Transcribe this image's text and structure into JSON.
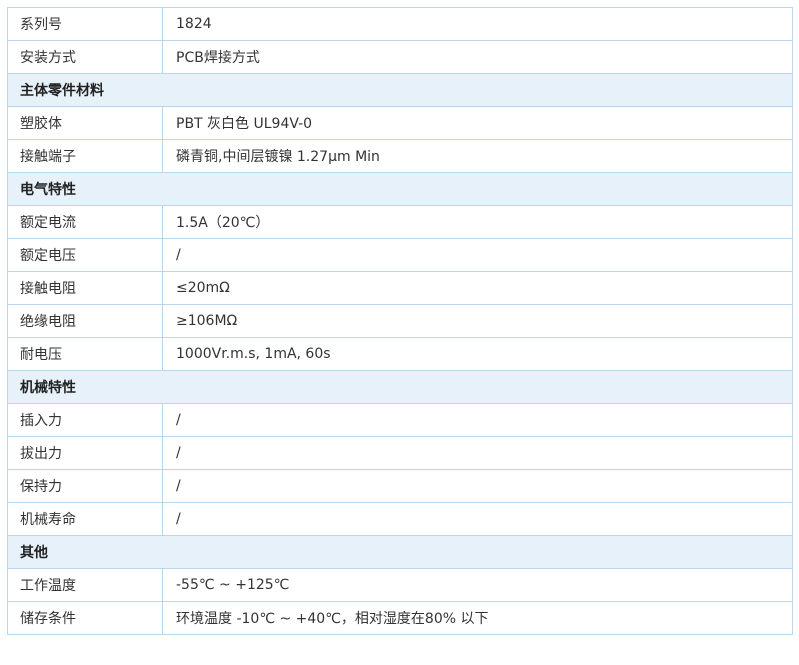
{
  "rows": [
    {
      "type": "row",
      "label": "系列号",
      "value": "1824"
    },
    {
      "type": "row",
      "label": "安装方式",
      "value": "PCB焊接方式"
    },
    {
      "type": "section",
      "label": "主体零件材料"
    },
    {
      "type": "row",
      "label": "塑胶体",
      "value": "PBT 灰白色 UL94V-0"
    },
    {
      "type": "row",
      "label": "接触端子",
      "value": "磷青铜,中间层镀镍 1.27μm Min"
    },
    {
      "type": "section",
      "label": "电气特性"
    },
    {
      "type": "row",
      "label": "额定电流",
      "value": "1.5A（20℃）"
    },
    {
      "type": "row",
      "label": "额定电压",
      "value": "/"
    },
    {
      "type": "row",
      "label": "接触电阻",
      "value": "≤20mΩ"
    },
    {
      "type": "row",
      "label": "绝缘电阻",
      "value": "≥106MΩ"
    },
    {
      "type": "row",
      "label": "耐电压",
      "value": "1000Vr.m.s, 1mA, 60s"
    },
    {
      "type": "section",
      "label": "机械特性"
    },
    {
      "type": "row",
      "label": "插入力",
      "value": "/"
    },
    {
      "type": "row",
      "label": "拔出力",
      "value": "/"
    },
    {
      "type": "row",
      "label": "保持力",
      "value": "/"
    },
    {
      "type": "row",
      "label": "机械寿命",
      "value": "/"
    },
    {
      "type": "section",
      "label": "其他"
    },
    {
      "type": "row",
      "label": "工作温度",
      "value": "-55℃ ~ +125℃"
    },
    {
      "type": "row",
      "label": "储存条件",
      "value": "环境温度 -10℃ ~ +40℃，相对湿度在80% 以下"
    }
  ]
}
